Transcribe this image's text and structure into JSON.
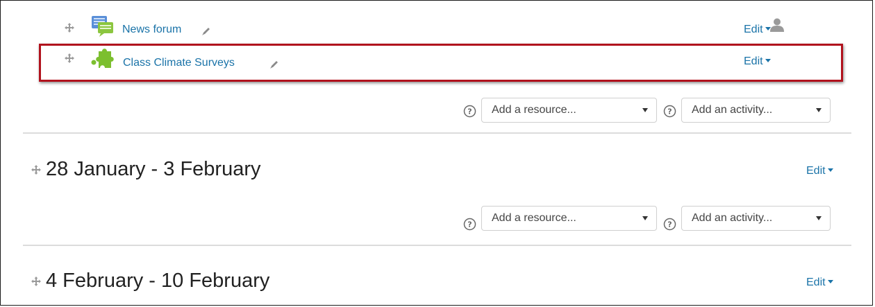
{
  "activities": [
    {
      "name": "News forum",
      "edit_label": "Edit",
      "icon": "forum-icon"
    },
    {
      "name": "Class Climate Surveys",
      "edit_label": "Edit",
      "icon": "puzzle-plugin-icon"
    }
  ],
  "add_resource_placeholder": "Add a resource...",
  "add_activity_placeholder": "Add an activity...",
  "sections": [
    {
      "title": "28 January - 3 February",
      "edit_label": "Edit"
    },
    {
      "title": "4 February - 10 February",
      "edit_label": "Edit"
    }
  ],
  "colors": {
    "link": "#1a73a8",
    "highlight": "#b1121d"
  }
}
